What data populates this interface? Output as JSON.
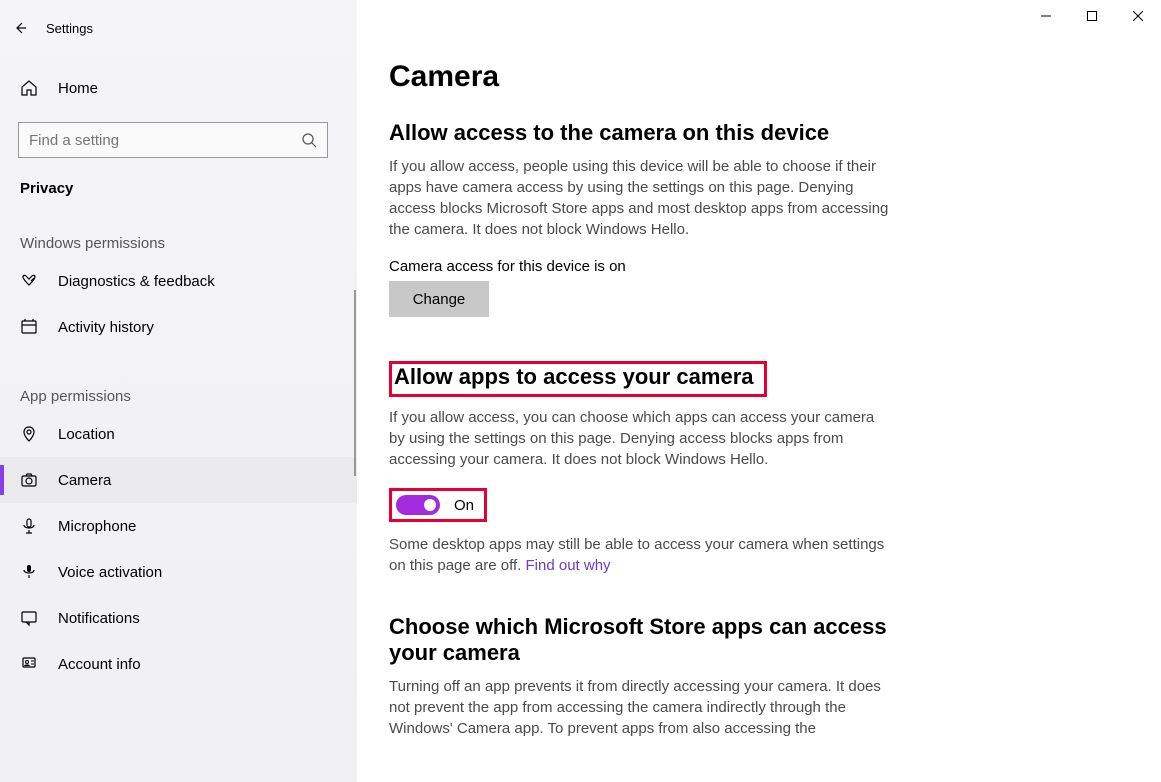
{
  "header": {
    "title": "Settings"
  },
  "window_controls": {
    "minimize": "minimize",
    "maximize": "maximize",
    "close": "close"
  },
  "sidebar": {
    "home": "Home",
    "search_placeholder": "Find a setting",
    "category": "Privacy",
    "groups": [
      {
        "label": "Windows permissions",
        "items": [
          {
            "icon": "diagnostics",
            "label": "Diagnostics & feedback"
          },
          {
            "icon": "activity",
            "label": "Activity history"
          }
        ]
      },
      {
        "label": "App permissions",
        "items": [
          {
            "icon": "location",
            "label": "Location"
          },
          {
            "icon": "camera",
            "label": "Camera",
            "selected": true
          },
          {
            "icon": "microphone",
            "label": "Microphone"
          },
          {
            "icon": "voice",
            "label": "Voice activation"
          },
          {
            "icon": "notifications",
            "label": "Notifications"
          },
          {
            "icon": "account",
            "label": "Account info"
          }
        ]
      }
    ]
  },
  "main": {
    "title": "Camera",
    "section1": {
      "heading": "Allow access to the camera on this device",
      "desc": "If you allow access, people using this device will be able to choose if their apps have camera access by using the settings on this page. Denying access blocks Microsoft Store apps and most desktop apps from accessing the camera. It does not block Windows Hello.",
      "status": "Camera access for this device is on",
      "change_btn": "Change"
    },
    "section2": {
      "heading": "Allow apps to access your camera",
      "desc": "If you allow access, you can choose which apps can access your camera by using the settings on this page. Denying access blocks apps from accessing your camera. It does not block Windows Hello.",
      "toggle_state": "On",
      "note_text": "Some desktop apps may still be able to access your camera when settings on this page are off. ",
      "note_link": "Find out why"
    },
    "section3": {
      "heading": "Choose which Microsoft Store apps can access your camera",
      "desc": "Turning off an app prevents it from directly accessing your camera. It does not prevent the app from accessing the camera indirectly through the Windows' Camera app. To prevent apps from also accessing the"
    }
  }
}
